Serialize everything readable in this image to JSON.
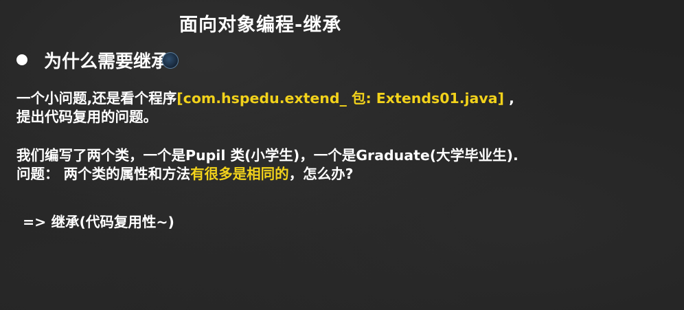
{
  "slide": {
    "title": "面向对象编程-继承",
    "bullet": "为什么需要继承",
    "paragraph1": {
      "line1_before": "一个小问题,还是看个程序",
      "line1_highlight": "[com.hspedu.extend_ 包: Extends01.java]",
      "line1_after": " ,",
      "line2": "提出代码复用的问题。"
    },
    "paragraph2": {
      "line1": "我们编写了两个类，一个是Pupil 类(小学生)，一个是Graduate(大学毕业生).",
      "line2_before": "问题： 两个类的属性和方法",
      "line2_highlight": "有很多是相同的",
      "line2_after": "，怎么办?"
    },
    "conclusion": "=> 继承(代码复用性~)"
  },
  "colors": {
    "background": "#232323",
    "text": "#ffffff",
    "highlight": "#f2d21b"
  }
}
